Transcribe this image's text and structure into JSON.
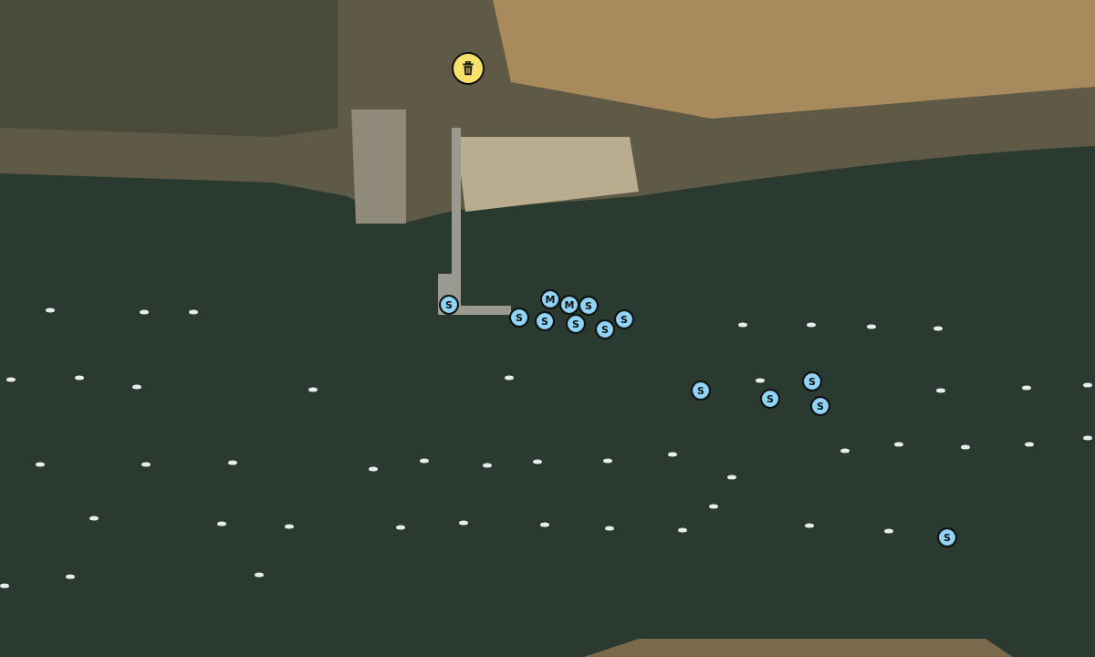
{
  "map": {
    "markers": [
      {
        "kind": "waste"
      },
      {
        "kind": "mooring",
        "label": "S"
      },
      {
        "kind": "mooring",
        "label": "S"
      },
      {
        "kind": "mooring",
        "label": "M"
      },
      {
        "kind": "mooring",
        "label": "S"
      },
      {
        "kind": "mooring",
        "label": "M"
      },
      {
        "kind": "mooring",
        "label": "S"
      },
      {
        "kind": "mooring",
        "label": "S"
      },
      {
        "kind": "mooring",
        "label": "S"
      },
      {
        "kind": "mooring",
        "label": "S"
      },
      {
        "kind": "mooring",
        "label": "S"
      },
      {
        "kind": "mooring",
        "label": "S"
      },
      {
        "kind": "mooring",
        "label": "S"
      },
      {
        "kind": "mooring",
        "label": "S"
      },
      {
        "kind": "mooring",
        "label": "S"
      }
    ]
  }
}
